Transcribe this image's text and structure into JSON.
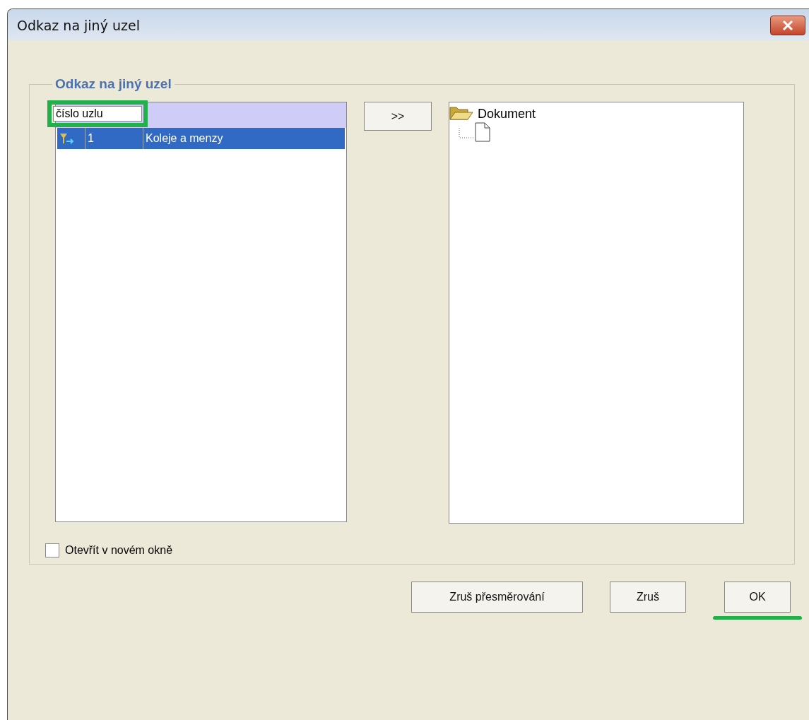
{
  "window": {
    "title": "Odkaz na jiný uzel"
  },
  "group": {
    "title": "Odkaz na jiný uzel"
  },
  "filter": {
    "value": "číslo uzlu",
    "highlighted": true
  },
  "rows": [
    {
      "number": "1",
      "name": "Koleje a menzy",
      "selected": true
    }
  ],
  "move_button": {
    "label": ">>"
  },
  "tree": [
    {
      "label": "Dokument",
      "kind": "folder",
      "expanded": true,
      "children": [
        {
          "kind": "page"
        }
      ]
    }
  ],
  "checkbox": {
    "label": "Otevřít v novém okně",
    "checked": false
  },
  "buttons": [
    {
      "label": "Zruš přesměrování",
      "underlined": false
    },
    {
      "label": "Zruš",
      "underlined": false
    },
    {
      "label": "OK",
      "underlined": true
    }
  ]
}
